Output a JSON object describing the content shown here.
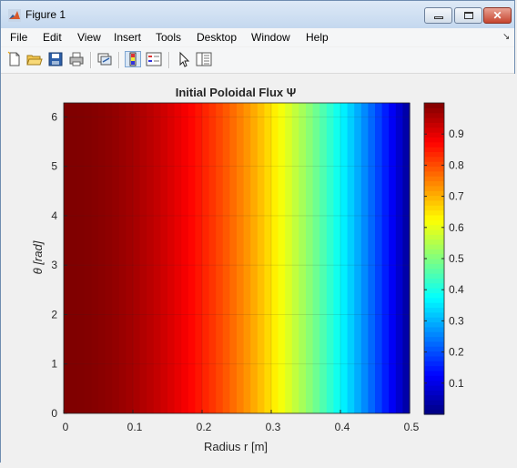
{
  "window": {
    "title": "Figure 1",
    "minimize_label": "_",
    "maximize_label": "□",
    "close_label": "✕"
  },
  "menu": {
    "items": [
      {
        "label": "File"
      },
      {
        "label": "Edit"
      },
      {
        "label": "View"
      },
      {
        "label": "Insert"
      },
      {
        "label": "Tools"
      },
      {
        "label": "Desktop"
      },
      {
        "label": "Window"
      },
      {
        "label": "Help"
      }
    ],
    "overflow_icon": "chevron-icon"
  },
  "toolbar": {
    "icons": [
      "new-figure-icon",
      "open-file-icon",
      "save-icon",
      "print-icon",
      "link-plot-icon",
      "colorbar-icon",
      "legend-icon",
      "pointer-icon",
      "property-inspector-icon"
    ]
  },
  "chart_data": {
    "type": "heatmap",
    "title": "Initial Poloidal Flux Ψ",
    "xlabel": "Radius r [m]",
    "ylabel": "θ [rad]",
    "xlim": [
      0,
      0.5
    ],
    "ylim": [
      0,
      6.2832
    ],
    "x_ticks": [
      "0",
      "0.1",
      "0.2",
      "0.3",
      "0.4",
      "0.5"
    ],
    "y_ticks": [
      "0",
      "1",
      "2",
      "3",
      "4",
      "5",
      "6"
    ],
    "grid": true,
    "colormap": "jet",
    "x": [
      0,
      0.01,
      0.02,
      0.03,
      0.04,
      0.05,
      0.06,
      0.07,
      0.08,
      0.09,
      0.1,
      0.11,
      0.12,
      0.13,
      0.14,
      0.15,
      0.16,
      0.17,
      0.18,
      0.19,
      0.2,
      0.21,
      0.22,
      0.23,
      0.24,
      0.25,
      0.26,
      0.27,
      0.28,
      0.29,
      0.3,
      0.31,
      0.32,
      0.33,
      0.34,
      0.35,
      0.36,
      0.37,
      0.38,
      0.39,
      0.4,
      0.41,
      0.42,
      0.43,
      0.44,
      0.45,
      0.46,
      0.47,
      0.48,
      0.49,
      0.5
    ],
    "values": [
      1.0,
      0.9996,
      0.9984,
      0.9964,
      0.9936,
      0.99,
      0.9856,
      0.9804,
      0.9744,
      0.9676,
      0.96,
      0.9516,
      0.9424,
      0.9324,
      0.9216,
      0.91,
      0.8976,
      0.8844,
      0.8704,
      0.8556,
      0.84,
      0.8236,
      0.8064,
      0.7884,
      0.7696,
      0.75,
      0.7296,
      0.7084,
      0.6864,
      0.6636,
      0.64,
      0.6156,
      0.5904,
      0.5644,
      0.5376,
      0.51,
      0.4816,
      0.4524,
      0.4224,
      0.3916,
      0.36,
      0.3276,
      0.2944,
      0.2604,
      0.2256,
      0.19,
      0.1536,
      0.1164,
      0.0784,
      0.0396,
      0.0
    ],
    "colorbar": {
      "ticks": [
        "0.1",
        "0.2",
        "0.3",
        "0.4",
        "0.5",
        "0.6",
        "0.7",
        "0.8",
        "0.9"
      ],
      "range": [
        0,
        1
      ]
    }
  }
}
